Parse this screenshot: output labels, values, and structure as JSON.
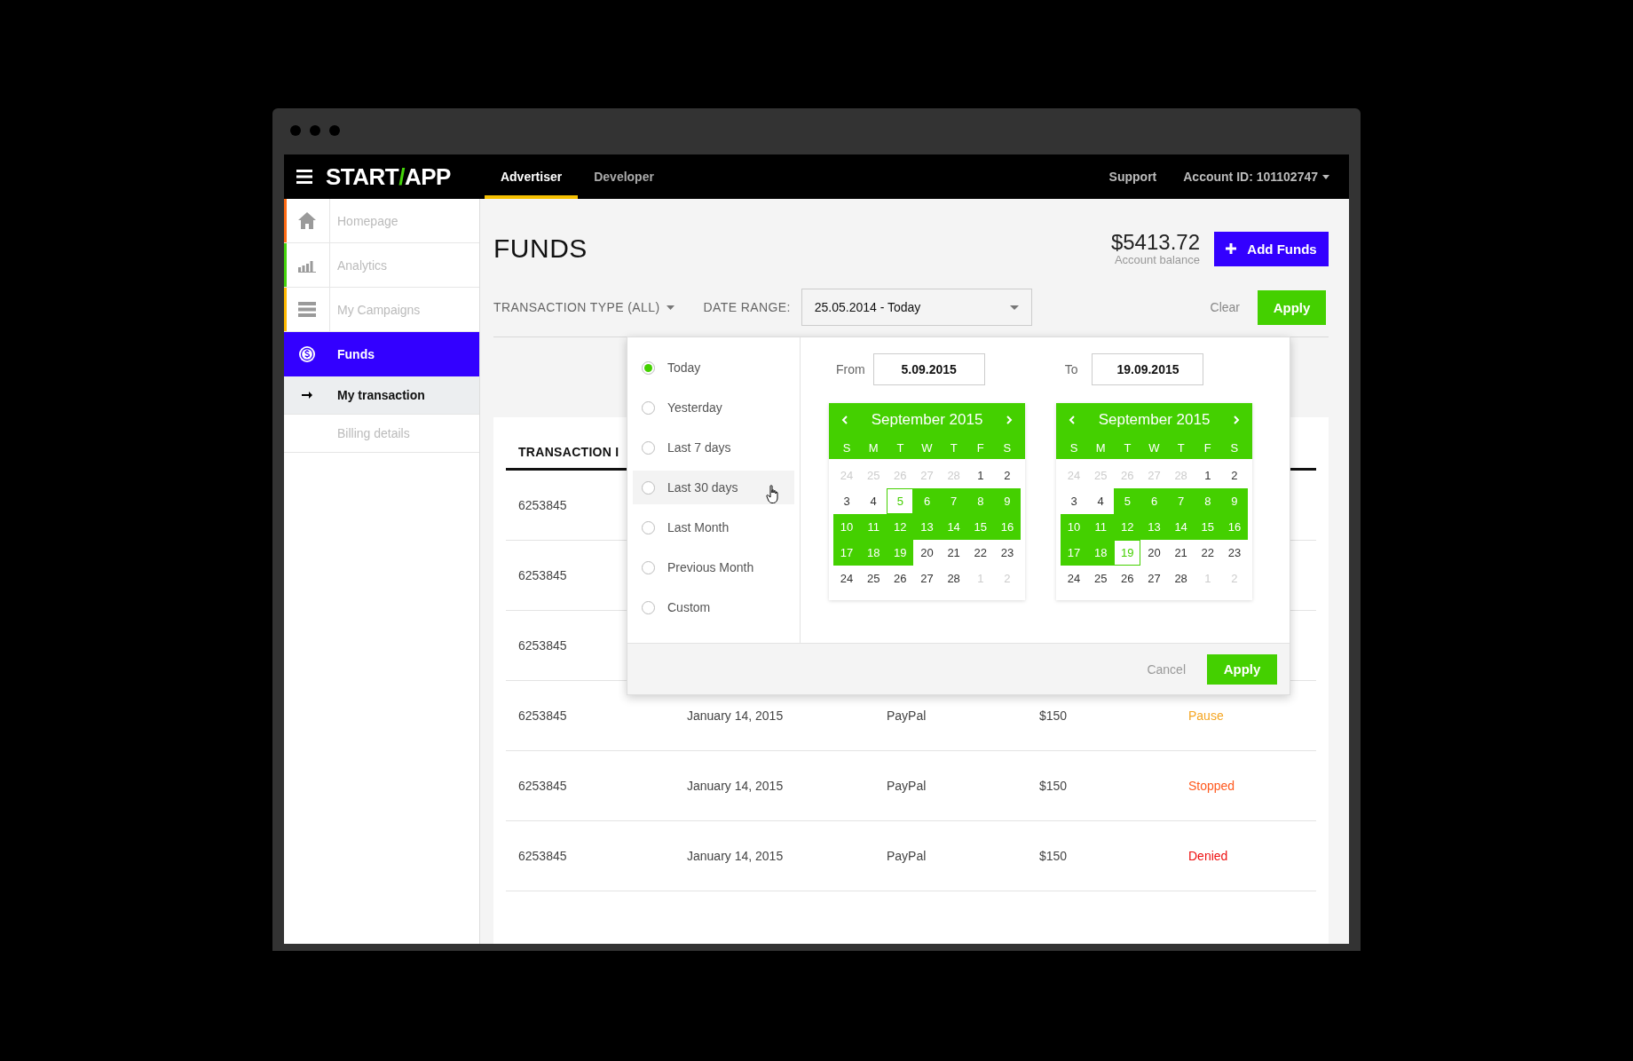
{
  "header": {
    "logo": [
      {
        "text": "START",
        "accent": false
      },
      {
        "text": "/",
        "accent": true
      },
      {
        "text": "APP",
        "accent": false
      }
    ],
    "tabs": [
      {
        "label": "Advertiser",
        "selected": true
      },
      {
        "label": "Developer",
        "selected": false
      }
    ],
    "support": "Support",
    "account": "Account ID: 101102747"
  },
  "sidebar": {
    "items": [
      {
        "label": "Homepage",
        "color": "#ff6a13",
        "selected": false
      },
      {
        "label": "Analytics",
        "color": "#44d40a",
        "selected": false
      },
      {
        "label": "My Campaigns",
        "color": "#ffb800",
        "selected": false
      },
      {
        "label": "Funds",
        "selected": true
      }
    ],
    "subitems": [
      {
        "label": "My transaction",
        "selected": true
      },
      {
        "label": "Billing details",
        "selected": false
      }
    ]
  },
  "page": {
    "title": "FUNDS",
    "balance": "$5413.72",
    "balance_label": "Account balance",
    "add_button": "Add Funds"
  },
  "filters": {
    "type": "TRANSACTION TYPE (ALL)",
    "date_label": "DATE RANGE:",
    "date_value": "25.05.2014 - Today",
    "clear": "Clear",
    "apply": "Apply"
  },
  "date_picker": {
    "presets": [
      {
        "label": "Today",
        "selected": true,
        "hovered": false
      },
      {
        "label": "Yesterday",
        "selected": false,
        "hovered": false
      },
      {
        "label": "Last 7 days",
        "selected": false,
        "hovered": false
      },
      {
        "label": "Last 30 days",
        "selected": false,
        "hovered": true
      },
      {
        "label": "Last Month",
        "selected": false,
        "hovered": false
      },
      {
        "label": "Previous Month",
        "selected": false,
        "hovered": false
      },
      {
        "label": "Custom",
        "selected": false,
        "hovered": false
      }
    ],
    "from_label": "From",
    "from": "5.09.2015",
    "to_label": "To",
    "to": "19.09.2015",
    "calendars": [
      {
        "title": "September 2015",
        "weekdays": [
          "S",
          "M",
          "T",
          "W",
          "T",
          "F",
          "S"
        ],
        "days": [
          {
            "d": "24",
            "kind": "muted"
          },
          {
            "d": "25",
            "kind": "muted"
          },
          {
            "d": "26",
            "kind": "muted"
          },
          {
            "d": "27",
            "kind": "muted"
          },
          {
            "d": "28",
            "kind": "muted"
          },
          {
            "d": "1",
            "kind": "plain"
          },
          {
            "d": "2",
            "kind": "plain"
          },
          {
            "d": "3",
            "kind": "plain"
          },
          {
            "d": "4",
            "kind": "plain"
          },
          {
            "d": "5",
            "kind": "edge"
          },
          {
            "d": "6",
            "kind": "range"
          },
          {
            "d": "7",
            "kind": "range"
          },
          {
            "d": "8",
            "kind": "range"
          },
          {
            "d": "9",
            "kind": "range"
          },
          {
            "d": "10",
            "kind": "range"
          },
          {
            "d": "11",
            "kind": "range"
          },
          {
            "d": "12",
            "kind": "range"
          },
          {
            "d": "13",
            "kind": "range"
          },
          {
            "d": "14",
            "kind": "range"
          },
          {
            "d": "15",
            "kind": "range"
          },
          {
            "d": "16",
            "kind": "range"
          },
          {
            "d": "17",
            "kind": "range"
          },
          {
            "d": "18",
            "kind": "range"
          },
          {
            "d": "19",
            "kind": "range"
          },
          {
            "d": "20",
            "kind": "plain"
          },
          {
            "d": "21",
            "kind": "plain"
          },
          {
            "d": "22",
            "kind": "plain"
          },
          {
            "d": "23",
            "kind": "plain"
          },
          {
            "d": "24",
            "kind": "plain"
          },
          {
            "d": "25",
            "kind": "plain"
          },
          {
            "d": "26",
            "kind": "plain"
          },
          {
            "d": "27",
            "kind": "plain"
          },
          {
            "d": "28",
            "kind": "plain"
          },
          {
            "d": "1",
            "kind": "muted"
          },
          {
            "d": "2",
            "kind": "muted"
          }
        ]
      },
      {
        "title": "September 2015",
        "weekdays": [
          "S",
          "M",
          "T",
          "W",
          "T",
          "F",
          "S"
        ],
        "days": [
          {
            "d": "24",
            "kind": "muted"
          },
          {
            "d": "25",
            "kind": "muted"
          },
          {
            "d": "26",
            "kind": "muted"
          },
          {
            "d": "27",
            "kind": "muted"
          },
          {
            "d": "28",
            "kind": "muted"
          },
          {
            "d": "1",
            "kind": "plain"
          },
          {
            "d": "2",
            "kind": "plain"
          },
          {
            "d": "3",
            "kind": "plain"
          },
          {
            "d": "4",
            "kind": "plain"
          },
          {
            "d": "5",
            "kind": "range"
          },
          {
            "d": "6",
            "kind": "range"
          },
          {
            "d": "7",
            "kind": "range"
          },
          {
            "d": "8",
            "kind": "range"
          },
          {
            "d": "9",
            "kind": "range"
          },
          {
            "d": "10",
            "kind": "range"
          },
          {
            "d": "11",
            "kind": "range"
          },
          {
            "d": "12",
            "kind": "range"
          },
          {
            "d": "13",
            "kind": "range"
          },
          {
            "d": "14",
            "kind": "range"
          },
          {
            "d": "15",
            "kind": "range"
          },
          {
            "d": "16",
            "kind": "range"
          },
          {
            "d": "17",
            "kind": "range"
          },
          {
            "d": "18",
            "kind": "range"
          },
          {
            "d": "19",
            "kind": "edge"
          },
          {
            "d": "20",
            "kind": "plain"
          },
          {
            "d": "21",
            "kind": "plain"
          },
          {
            "d": "22",
            "kind": "plain"
          },
          {
            "d": "23",
            "kind": "plain"
          },
          {
            "d": "24",
            "kind": "plain"
          },
          {
            "d": "25",
            "kind": "plain"
          },
          {
            "d": "26",
            "kind": "plain"
          },
          {
            "d": "27",
            "kind": "plain"
          },
          {
            "d": "28",
            "kind": "plain"
          },
          {
            "d": "1",
            "kind": "muted"
          },
          {
            "d": "2",
            "kind": "muted"
          }
        ]
      }
    ],
    "cancel": "Cancel",
    "apply": "Apply"
  },
  "table": {
    "columns": [
      "TRANSACTION I"
    ],
    "rows": [
      {
        "id": "6253845"
      },
      {
        "id": "6253845"
      },
      {
        "id": "6253845"
      },
      {
        "id": "6253845",
        "date": "January 14, 2015",
        "method": "PayPal",
        "amount": "$150",
        "status": "Pause",
        "color": "#f5a623"
      },
      {
        "id": "6253845",
        "date": "January 14, 2015",
        "method": "PayPal",
        "amount": "$150",
        "status": "Stopped",
        "color": "#ff5a1f"
      },
      {
        "id": "6253845",
        "date": "January 14, 2015",
        "method": "PayPal",
        "amount": "$150",
        "status": "Denied",
        "color": "#ee1111"
      }
    ]
  }
}
